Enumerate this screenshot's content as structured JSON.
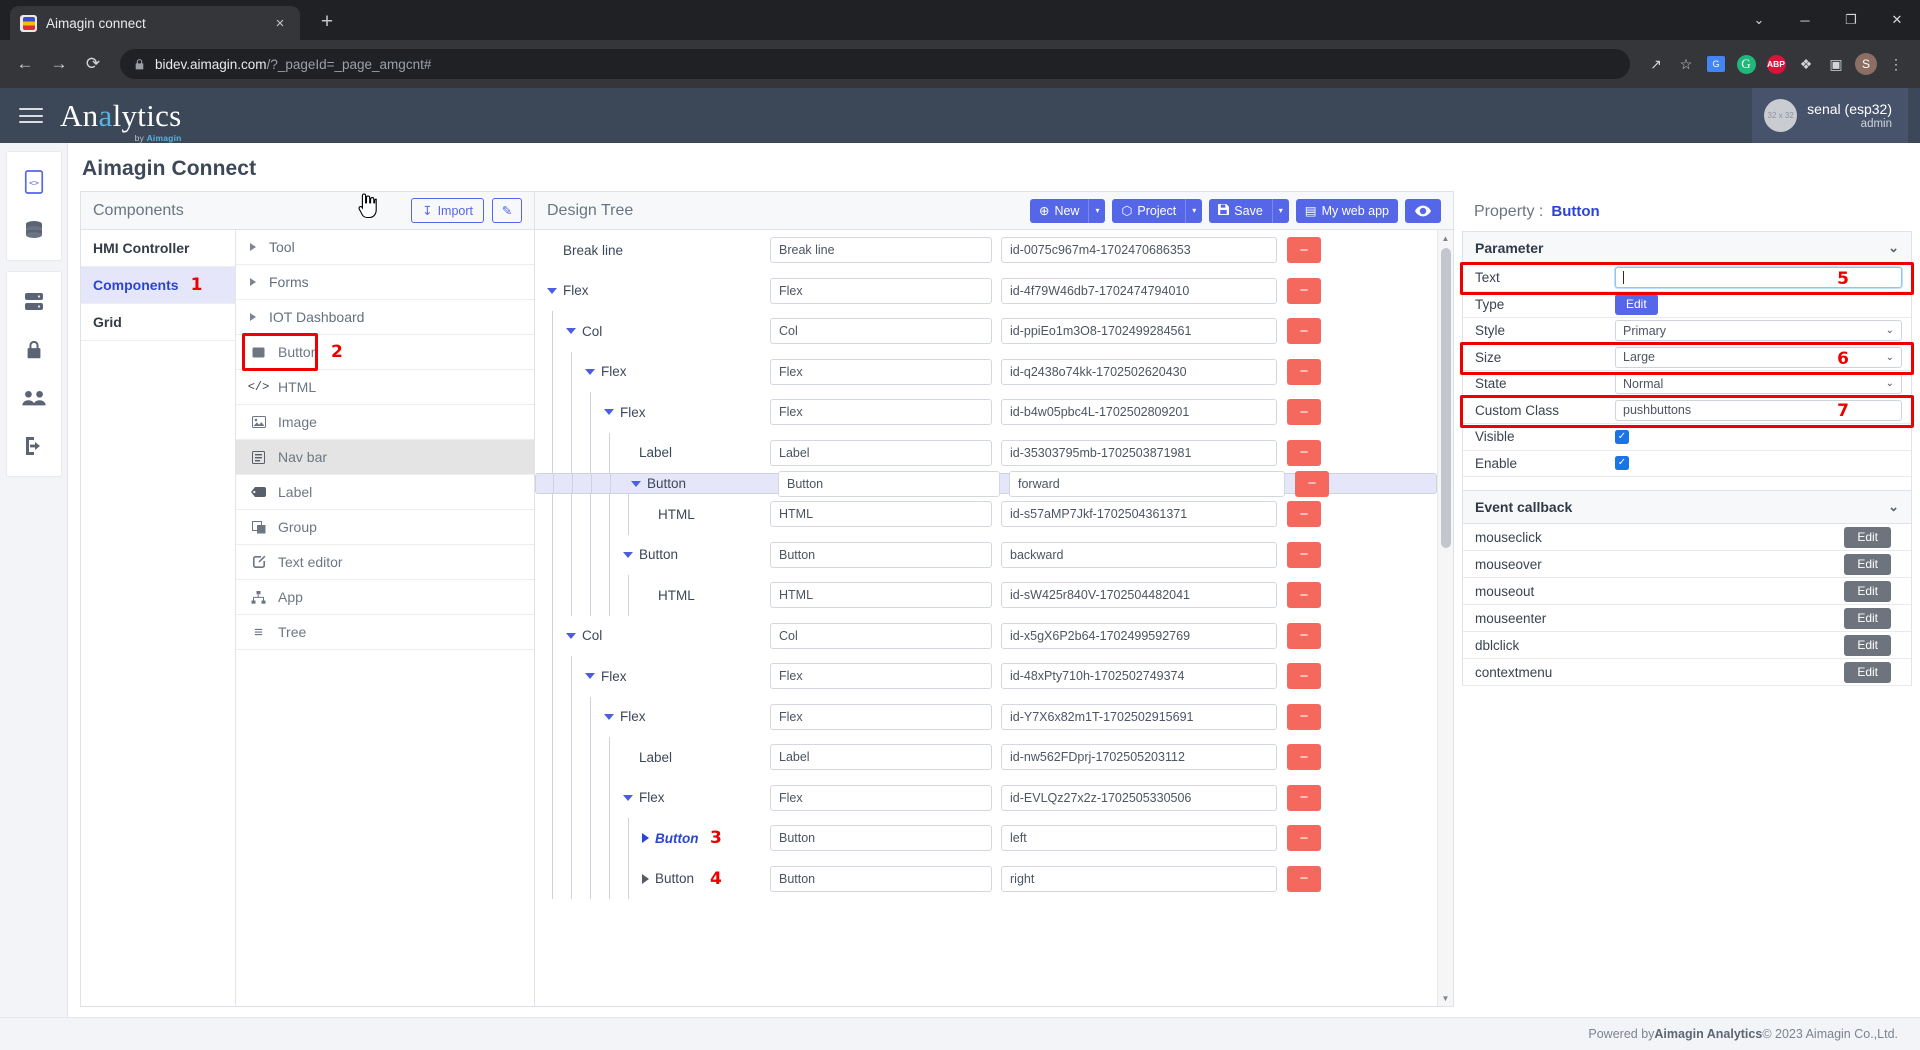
{
  "browser": {
    "tab_title": "Aimagin connect",
    "tab_close": "×",
    "new_tab": "+",
    "minimize": "─",
    "maximize": "❐",
    "close": "✕",
    "chevron_down": "⌄",
    "back": "←",
    "forward": "→",
    "reload": "⟳",
    "url_domain": "bidev.aimagin.com",
    "url_path": "/?_pageId=_page_amgcnt#",
    "share_icon": "↗",
    "star_icon": "☆",
    "translate_badge": "G",
    "grammarly_badge": "G",
    "adblock_badge": "ABP",
    "extensions_icon": "❖",
    "sidepanel_icon": "▣",
    "profile_badge": "S",
    "menu_icon": "⋮"
  },
  "app_header": {
    "brand_part1": "An",
    "brand_accent": "a",
    "brand_part2": "lytics",
    "brand_sub_prefix": "by ",
    "brand_sub_name": "Aimagin",
    "avatar_placeholder": "32 x 32",
    "user_name": "senal (esp32)",
    "user_role": "admin"
  },
  "rail": {
    "items": [
      {
        "name": "code-file-icon"
      },
      {
        "name": "database-icon"
      },
      {
        "name": "server-icon"
      },
      {
        "name": "lock-icon"
      },
      {
        "name": "users-icon"
      },
      {
        "name": "logout-icon"
      }
    ]
  },
  "page": {
    "title": "Aimagin Connect"
  },
  "components_panel": {
    "title": "Components",
    "import_label": "Import",
    "import_icon": "↧",
    "edit_icon": "✎",
    "categories": [
      {
        "label": "HMI Controller",
        "active": false
      },
      {
        "label": "Components",
        "active": true
      },
      {
        "label": "Grid",
        "active": false
      }
    ],
    "groups": [
      {
        "label": "Tool"
      },
      {
        "label": "Forms"
      },
      {
        "label": "IOT Dashboard"
      }
    ],
    "items": [
      {
        "label": "Button",
        "icon": "square-icon",
        "glyph": "■",
        "highlighted": true,
        "hover": false
      },
      {
        "label": "HTML",
        "icon": "code-icon",
        "glyph": "</>",
        "highlighted": false,
        "hover": false
      },
      {
        "label": "Image",
        "icon": "image-icon",
        "glyph": "Ὓb",
        "highlighted": false,
        "hover": false
      },
      {
        "label": "Nav bar",
        "icon": "navbar-icon",
        "glyph": "☰",
        "highlighted": false,
        "hover": true
      },
      {
        "label": "Label",
        "icon": "tag-icon",
        "glyph": "⬛",
        "highlighted": false,
        "hover": false
      },
      {
        "label": "Group",
        "icon": "group-icon",
        "glyph": "◰",
        "highlighted": false,
        "hover": false
      },
      {
        "label": "Text editor",
        "icon": "pencil-square-icon",
        "glyph": "✎",
        "highlighted": false,
        "hover": false
      },
      {
        "label": "App",
        "icon": "sitemap-icon",
        "glyph": "⑂",
        "highlighted": false,
        "hover": false
      },
      {
        "label": "Tree",
        "icon": "list-icon",
        "glyph": "≡",
        "highlighted": false,
        "hover": false
      }
    ]
  },
  "design_tree": {
    "title": "Design Tree",
    "buttons": {
      "new": "New",
      "new_icon": "⊕",
      "project": "Project",
      "project_icon": "⬡",
      "save": "Save",
      "save_icon": "὚b",
      "mywebapp": "My web app",
      "mywebapp_icon": "▤",
      "preview_icon": "◉",
      "caret": "▾"
    },
    "delete_glyph": "−",
    "rows": [
      {
        "name": "Break line",
        "indent": 0,
        "caret": "none",
        "type": "Break line",
        "id": "id-0075c967m4-1702470686353",
        "selected": false,
        "italic": false
      },
      {
        "name": "Flex",
        "indent": 0,
        "caret": "open",
        "type": "Flex",
        "id": "id-4f79W46db7-1702474794010",
        "selected": false,
        "italic": false
      },
      {
        "name": "Col",
        "indent": 1,
        "caret": "open",
        "type": "Col",
        "id": "id-ppiEo1m3O8-1702499284561",
        "selected": false,
        "italic": false
      },
      {
        "name": "Flex",
        "indent": 2,
        "caret": "open",
        "type": "Flex",
        "id": "id-q2438o74kk-1702502620430",
        "selected": false,
        "italic": false
      },
      {
        "name": "Flex",
        "indent": 3,
        "caret": "open",
        "type": "Flex",
        "id": "id-b4w05pbc4L-1702502809201",
        "selected": false,
        "italic": false
      },
      {
        "name": "Label",
        "indent": 4,
        "caret": "none",
        "type": "Label",
        "id": "id-35303795mb-1702503871981",
        "selected": false,
        "italic": false
      },
      {
        "name": "Button",
        "indent": 4,
        "caret": "open",
        "type": "Button",
        "id": "forward",
        "selected": true,
        "italic": false
      },
      {
        "name": "HTML",
        "indent": 5,
        "caret": "none",
        "type": "HTML",
        "id": "id-s57aMP7Jkf-1702504361371",
        "selected": false,
        "italic": false
      },
      {
        "name": "Button",
        "indent": 4,
        "caret": "open",
        "type": "Button",
        "id": "backward",
        "selected": false,
        "italic": false
      },
      {
        "name": "HTML",
        "indent": 5,
        "caret": "none",
        "type": "HTML",
        "id": "id-sW425r840V-1702504482041",
        "selected": false,
        "italic": false
      },
      {
        "name": "Col",
        "indent": 1,
        "caret": "open",
        "type": "Col",
        "id": "id-x5gX6P2b64-1702499592769",
        "selected": false,
        "italic": false
      },
      {
        "name": "Flex",
        "indent": 2,
        "caret": "open",
        "type": "Flex",
        "id": "id-48xPty710h-1702502749374",
        "selected": false,
        "italic": false
      },
      {
        "name": "Flex",
        "indent": 3,
        "caret": "open",
        "type": "Flex",
        "id": "id-Y7X6x82m1T-1702502915691",
        "selected": false,
        "italic": false
      },
      {
        "name": "Label",
        "indent": 4,
        "caret": "none",
        "type": "Label",
        "id": "id-nw562FDprj-1702505203112",
        "selected": false,
        "italic": false
      },
      {
        "name": "Flex",
        "indent": 4,
        "caret": "open",
        "type": "Flex",
        "id": "id-EVLQz27x2z-1702505330506",
        "selected": false,
        "italic": false
      },
      {
        "name": "Button",
        "indent": 5,
        "caret": "closed-blue",
        "type": "Button",
        "id": "left",
        "selected": false,
        "italic": true
      },
      {
        "name": "Button",
        "indent": 5,
        "caret": "closed",
        "type": "Button",
        "id": "right",
        "selected": false,
        "italic": false
      }
    ],
    "scroll_up": "▲",
    "scroll_down": "▼"
  },
  "property_panel": {
    "title_label": "Property :",
    "title_value": "Button",
    "section_parameter": "Parameter",
    "section_event": "Event callback",
    "collapse_chevron": "⌄",
    "parameters": [
      {
        "label": "Text",
        "kind": "input",
        "value": "",
        "focused": true
      },
      {
        "label": "Type",
        "kind": "button",
        "value": "Edit"
      },
      {
        "label": "Style",
        "kind": "select",
        "value": "Primary"
      },
      {
        "label": "Size",
        "kind": "select",
        "value": "Large"
      },
      {
        "label": "State",
        "kind": "select",
        "value": "Normal"
      },
      {
        "label": "Custom Class",
        "kind": "input",
        "value": "pushbuttons",
        "focused": false
      },
      {
        "label": "Visible",
        "kind": "checkbox",
        "value": true
      },
      {
        "label": "Enable",
        "kind": "checkbox",
        "value": true
      }
    ],
    "events": [
      {
        "label": "mouseclick",
        "button": "Edit"
      },
      {
        "label": "mouseover",
        "button": "Edit"
      },
      {
        "label": "mouseout",
        "button": "Edit"
      },
      {
        "label": "mouseenter",
        "button": "Edit"
      },
      {
        "label": "dblclick",
        "button": "Edit"
      },
      {
        "label": "contextmenu",
        "button": "Edit"
      }
    ],
    "checkmark": "✓"
  },
  "annotations": {
    "n1": "1",
    "n2": "2",
    "n3": "3",
    "n4": "4",
    "n5": "5",
    "n6": "6",
    "n7": "7"
  },
  "footer": {
    "prefix": "Powered by ",
    "brand": "Aimagin Analytics",
    "suffix": " © 2023 Aimagin Co.,Ltd."
  }
}
